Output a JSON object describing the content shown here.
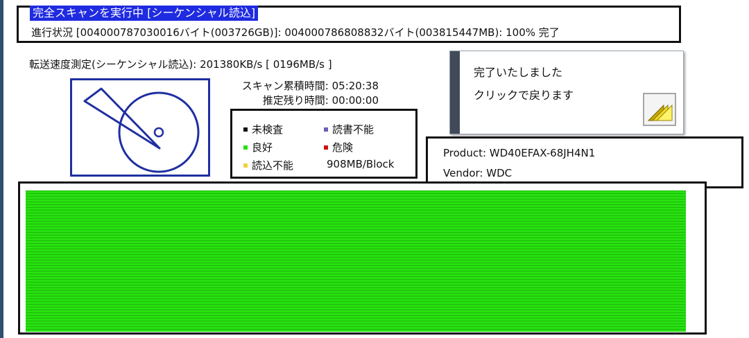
{
  "header": {
    "title": "完全スキャンを実行中 [シーケンシャル読込]",
    "progress": "進行状況 [004000787030016バイト(003726GB)]: 004000786808832バイト(003815447MB): 100% 完了"
  },
  "speed": {
    "text": "転送速度測定(シーケンシャル読込): 201380KB/s [ 0196MB/s ]"
  },
  "times": {
    "elapsed": "スキャン累積時間: 05:20:38",
    "remaining": "推定残り時間: 00:00:00"
  },
  "legend": {
    "items": [
      {
        "label": "未検査",
        "color": "#111111"
      },
      {
        "label": "読書不能",
        "color": "#6b5fb5"
      },
      {
        "label": "良好",
        "color": "#27e010"
      },
      {
        "label": "危険",
        "color": "#d01010"
      },
      {
        "label": "読込不能",
        "color": "#f0d040"
      }
    ],
    "block_size": "908MB/Block"
  },
  "complete": {
    "line1": "完了いたしました",
    "line2": "クリックで戻ります",
    "icon": "return-icon"
  },
  "device": {
    "product": "Product: WD40EFAX-68JH4N1",
    "vendor": "Vendor: WDC"
  },
  "scan_map": {
    "status_color": "#27e010",
    "completion_percent": 100
  }
}
